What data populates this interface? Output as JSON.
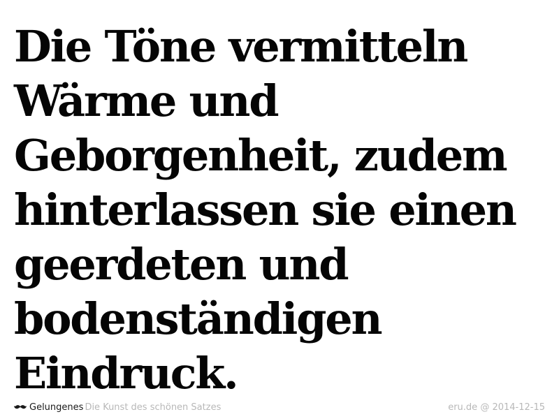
{
  "headline": {
    "lines": [
      "Die Töne vermitteln",
      "Wärme und",
      "Geborgenheit, zudem",
      "hinterlassen sie einen",
      "geerdeten und",
      "bodenständigen",
      "Eindruck."
    ]
  },
  "footer": {
    "logo_icon": "mustache-icon",
    "brand": "Gelungenes",
    "tagline": "Die Kunst des schönen Satzes",
    "credit": "eru.de @ 2014-12-15"
  },
  "colors": {
    "text": "#050505",
    "muted": "#b8b8b8",
    "background": "#ffffff"
  }
}
